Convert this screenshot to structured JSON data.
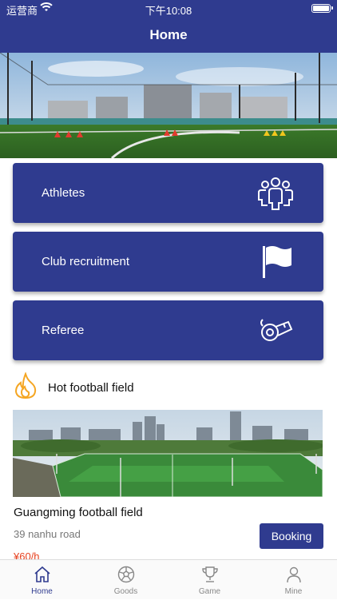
{
  "status_bar": {
    "carrier": "运营商",
    "time": "下午10:08"
  },
  "header": {
    "title": "Home"
  },
  "cards": [
    {
      "label": "Athletes",
      "icon": "people-group-icon"
    },
    {
      "label": "Club recruitment",
      "icon": "flag-icon"
    },
    {
      "label": "Referee",
      "icon": "whistle-icon"
    }
  ],
  "hot_section": {
    "title": "Hot football field",
    "icon": "fire-icon"
  },
  "field": {
    "name": "Guangming football field",
    "address": "39 nanhu road",
    "price": "¥60/h",
    "booking_label": "Booking"
  },
  "tabs": [
    {
      "label": "Home",
      "icon": "home-icon",
      "active": true
    },
    {
      "label": "Goods",
      "icon": "soccer-ball-icon",
      "active": false
    },
    {
      "label": "Game",
      "icon": "trophy-icon",
      "active": false
    },
    {
      "label": "Mine",
      "icon": "person-icon",
      "active": false
    }
  ],
  "colors": {
    "primary": "#2f3b8f",
    "price": "#e6411f",
    "fire": "#f5a623"
  }
}
